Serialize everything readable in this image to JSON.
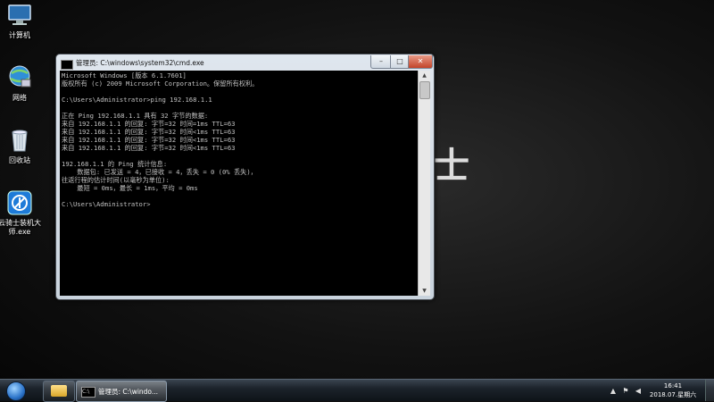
{
  "desktop": {
    "icons": [
      {
        "label": "计算机",
        "icon": "computer-icon"
      },
      {
        "label": "网络",
        "icon": "network-icon"
      },
      {
        "label": "回收站",
        "icon": "recycle-bin-icon"
      },
      {
        "label": "云骑士装机大师.exe",
        "icon": "app-icon"
      }
    ],
    "art_char": "士"
  },
  "window": {
    "title": "管理员: C:\\windows\\system32\\cmd.exe",
    "minimize": "–",
    "maximize": "□",
    "close": "✕"
  },
  "console": {
    "lines": [
      "Microsoft Windows [版本 6.1.7601]",
      "版权所有 (c) 2009 Microsoft Corporation。保留所有权利。",
      "",
      "C:\\Users\\Administrator>ping 192.168.1.1",
      "",
      "正在 Ping 192.168.1.1 具有 32 字节的数据:",
      "来自 192.168.1.1 的回复: 字节=32 时间=1ms TTL=63",
      "来自 192.168.1.1 的回复: 字节=32 时间<1ms TTL=63",
      "来自 192.168.1.1 的回复: 字节=32 时间<1ms TTL=63",
      "来自 192.168.1.1 的回复: 字节=32 时间<1ms TTL=63",
      "",
      "192.168.1.1 的 Ping 统计信息:",
      "    数据包: 已发送 = 4，已接收 = 4，丢失 = 0 (0% 丢失)，",
      "往返行程的估计时间(以毫秒为单位):",
      "    最短 = 0ms，最长 = 1ms，平均 = 0ms",
      "",
      "C:\\Users\\Administrator>"
    ]
  },
  "taskbar": {
    "task_label": "管理员: C:\\windo...",
    "clock_time": "16:41",
    "clock_date": "2018.07.星期六"
  }
}
